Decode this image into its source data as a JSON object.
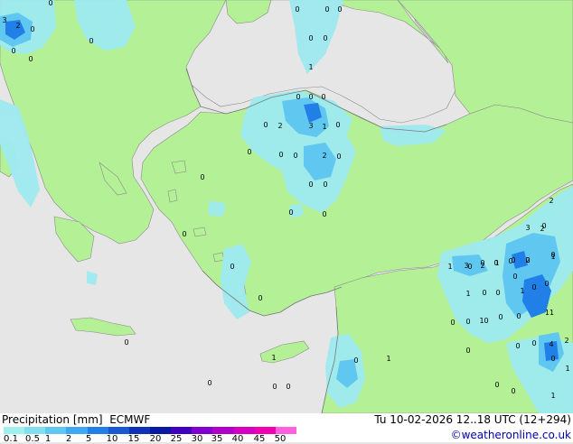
{
  "footer": {
    "title": "Precipitation [mm]  ECMWF",
    "valid_time": "Tu 10-02-2026 12..18 UTC (12+294)",
    "credit": "©weatheronline.co.uk"
  },
  "legend": {
    "labels": [
      "0.1",
      "0.5",
      "1",
      "2",
      "5",
      "10",
      "15",
      "20",
      "25",
      "30",
      "35",
      "40",
      "45",
      "50"
    ],
    "colors": [
      "#a0f0f0",
      "#80e0f0",
      "#60c8f0",
      "#40a8f0",
      "#2080e8",
      "#1858d0",
      "#1030b8",
      "#0818a0",
      "#4000c0",
      "#8000d0",
      "#b000c8",
      "#d800c0",
      "#f000b0",
      "#ff60e0"
    ]
  },
  "colors": {
    "land": "#b4f096",
    "sea": "#e6e6e6",
    "precip_light": "#9eeaf0",
    "precip_medium": "#60c8f0",
    "precip_heavy": "#2080e8"
  },
  "values": [
    {
      "t": "3"
    },
    {
      "t": "2"
    },
    {
      "t": "0"
    },
    {
      "t": "0"
    },
    {
      "t": "0"
    },
    {
      "t": "0"
    },
    {
      "t": "0"
    },
    {
      "t": "0"
    },
    {
      "t": "0"
    },
    {
      "t": "0"
    },
    {
      "t": "0"
    },
    {
      "t": "0"
    },
    {
      "t": "1"
    },
    {
      "t": "0"
    },
    {
      "t": "0"
    },
    {
      "t": "0"
    },
    {
      "t": "0"
    },
    {
      "t": "2"
    },
    {
      "t": "3"
    },
    {
      "t": "1"
    },
    {
      "t": "0"
    },
    {
      "t": "0"
    },
    {
      "t": "0"
    },
    {
      "t": "0"
    },
    {
      "t": "2"
    },
    {
      "t": "0"
    },
    {
      "t": "0"
    },
    {
      "t": "0"
    },
    {
      "t": "0"
    },
    {
      "t": "0"
    },
    {
      "t": "0"
    },
    {
      "t": "0"
    },
    {
      "t": "0"
    },
    {
      "t": "0"
    },
    {
      "t": "0"
    },
    {
      "t": "1"
    },
    {
      "t": "0"
    },
    {
      "t": "0"
    },
    {
      "t": "1"
    },
    {
      "t": "0"
    },
    {
      "t": "0"
    },
    {
      "t": "0"
    },
    {
      "t": "0"
    },
    {
      "t": "0"
    },
    {
      "t": "0"
    },
    {
      "t": "0"
    },
    {
      "t": "2"
    },
    {
      "t": "3"
    },
    {
      "t": "2"
    },
    {
      "t": "0"
    },
    {
      "t": "1"
    },
    {
      "t": "3"
    },
    {
      "t": "2"
    },
    {
      "t": "1"
    },
    {
      "t": "0"
    },
    {
      "t": "2"
    },
    {
      "t": "0"
    },
    {
      "t": "1"
    },
    {
      "t": "0"
    },
    {
      "t": "0"
    },
    {
      "t": "0"
    },
    {
      "t": "1"
    },
    {
      "t": "1"
    },
    {
      "t": "0"
    },
    {
      "t": "0"
    },
    {
      "t": "0"
    },
    {
      "t": "0"
    },
    {
      "t": "1"
    },
    {
      "t": "11"
    },
    {
      "t": "0"
    },
    {
      "t": "0"
    },
    {
      "t": "0"
    },
    {
      "t": "0"
    },
    {
      "t": "0"
    },
    {
      "t": "0"
    },
    {
      "t": "4"
    },
    {
      "t": "2"
    },
    {
      "t": "0"
    },
    {
      "t": "1"
    },
    {
      "t": "0"
    },
    {
      "t": "0"
    },
    {
      "t": "1"
    }
  ]
}
